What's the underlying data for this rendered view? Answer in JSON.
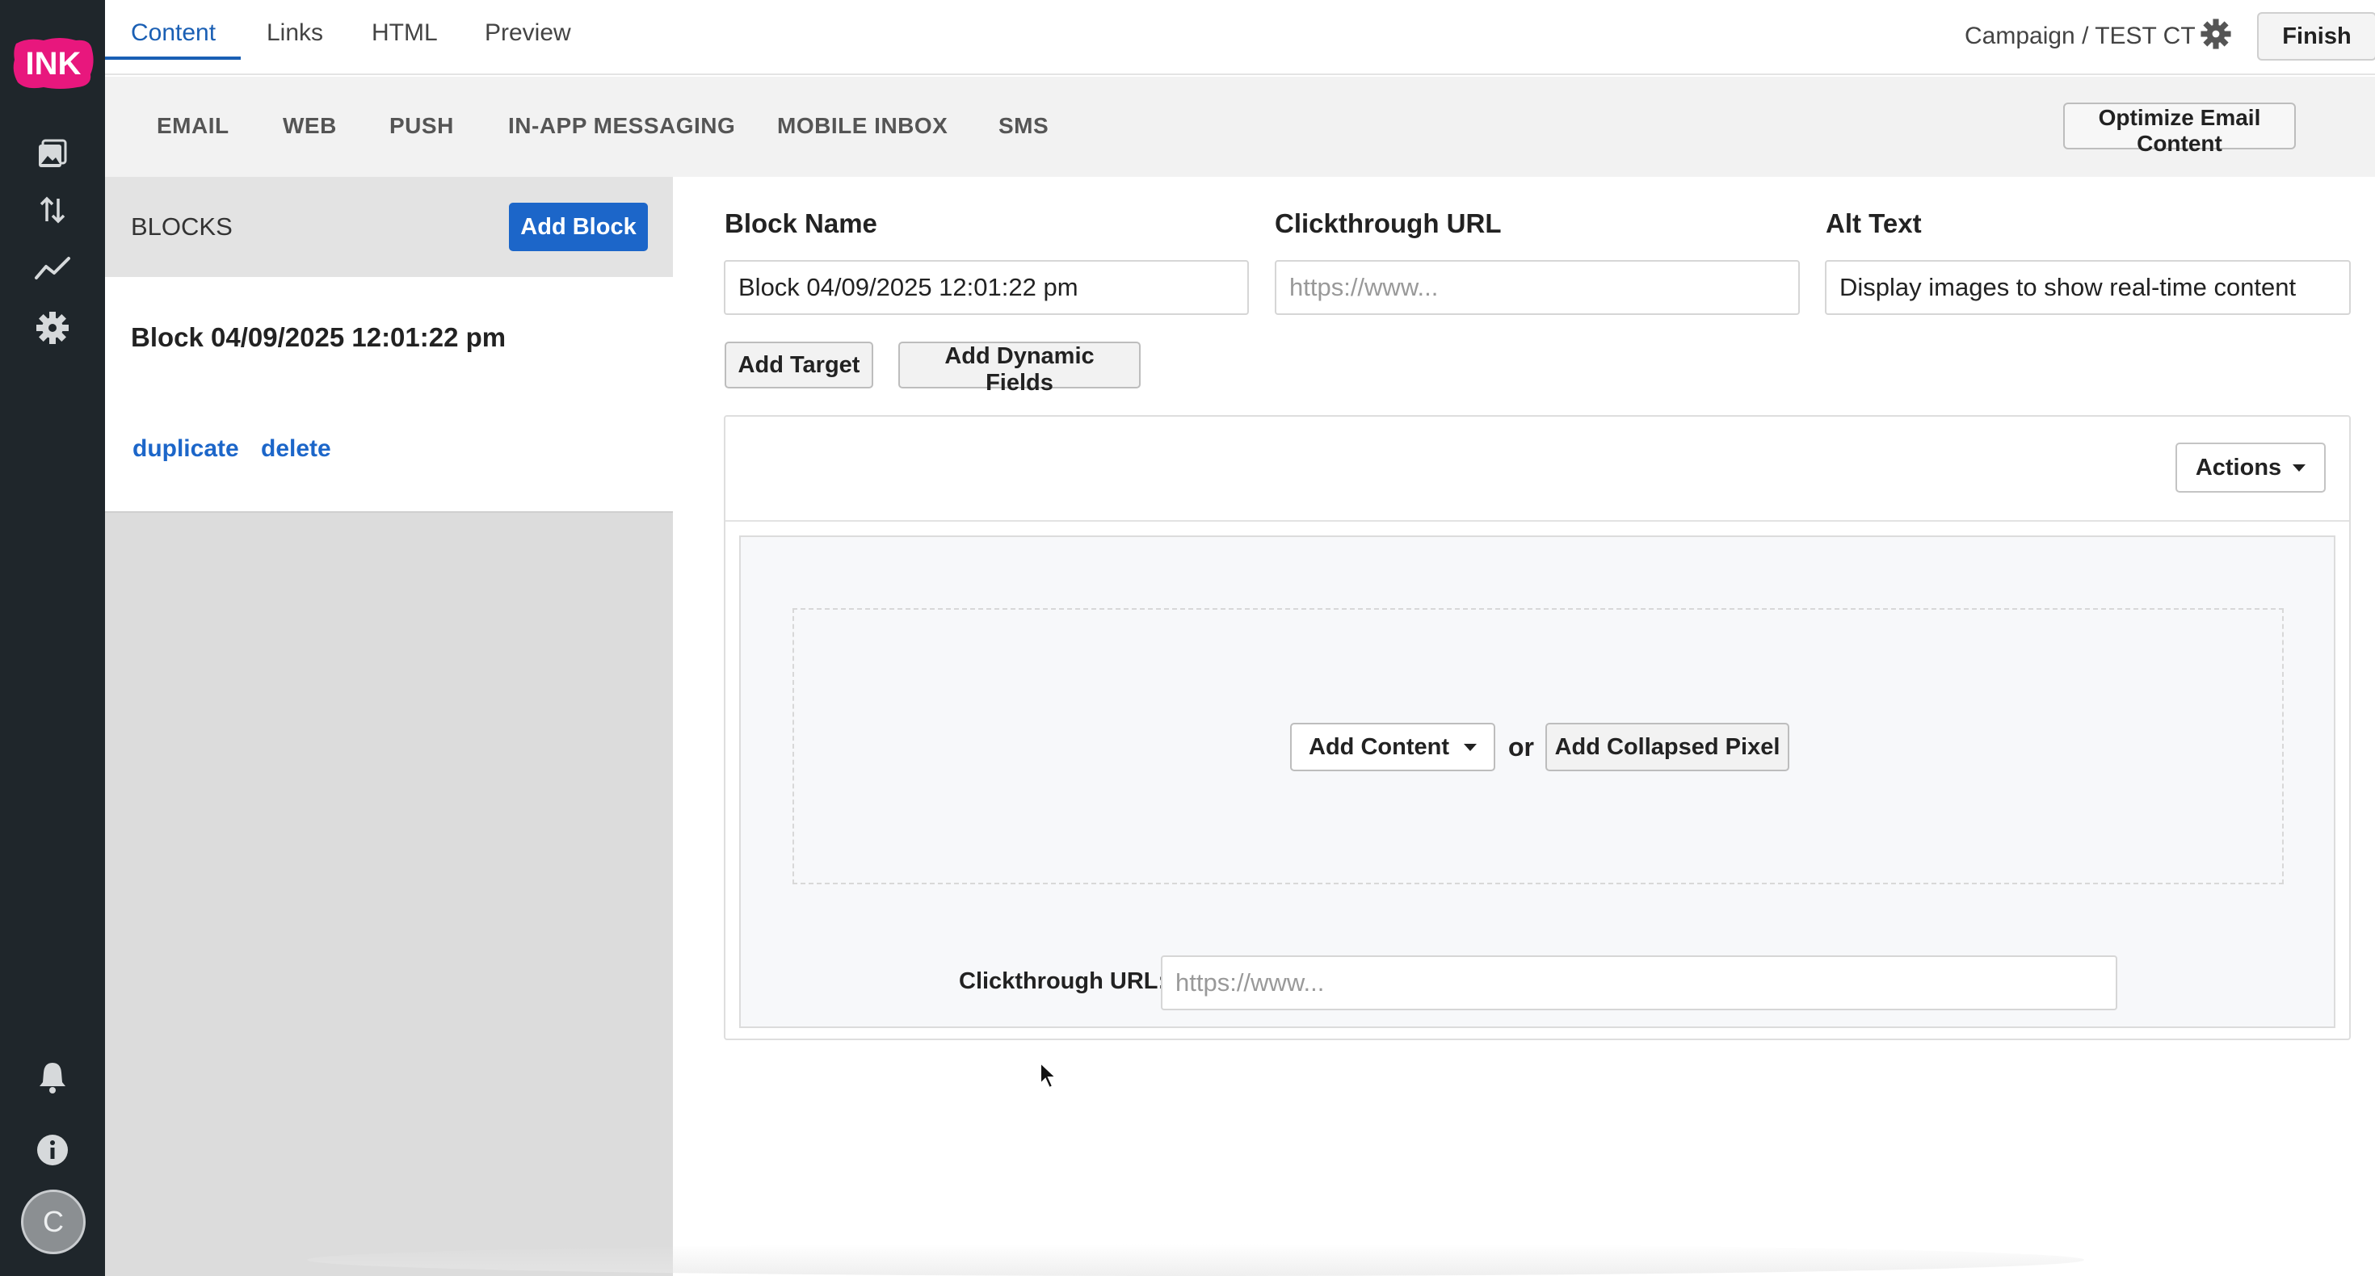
{
  "app": {
    "logo_text": "INK",
    "avatar_initial": "C",
    "brand_color": "#e8177d",
    "accent_color": "#1c66c9"
  },
  "rail": {
    "icons": [
      "image-icon",
      "sort-arrows-icon",
      "analytics-trend-icon",
      "settings-gear-icon"
    ],
    "bottom_icons": [
      "notification-bell-icon",
      "info-icon"
    ]
  },
  "top_tabs": [
    {
      "label": "Content",
      "active": true
    },
    {
      "label": "Links",
      "active": false
    },
    {
      "label": "HTML",
      "active": false
    },
    {
      "label": "Preview",
      "active": false
    }
  ],
  "header": {
    "breadcrumb": "Campaign / TEST CT",
    "finish_label": "Finish"
  },
  "channels": [
    {
      "label": "EMAIL"
    },
    {
      "label": "WEB"
    },
    {
      "label": "PUSH"
    },
    {
      "label": "IN-APP MESSAGING"
    },
    {
      "label": "MOBILE INBOX"
    },
    {
      "label": "SMS"
    }
  ],
  "optimize_label": "Optimize Email Content",
  "blocks": {
    "title": "BLOCKS",
    "add_label": "Add Block",
    "items": [
      {
        "name": "Block 04/09/2025 12:01:22 pm",
        "duplicate_label": "duplicate",
        "delete_label": "delete"
      }
    ]
  },
  "editor": {
    "block_name_label": "Block Name",
    "block_name_value": "Block 04/09/2025 12:01:22 pm",
    "clickthrough_label": "Clickthrough URL",
    "clickthrough_placeholder": "https://www...",
    "alt_text_label": "Alt Text",
    "alt_text_value": "Display images to show real-time content",
    "add_target_label": "Add Target",
    "add_dynamic_label": "Add Dynamic Fields",
    "actions_label": "Actions",
    "add_content_label": "Add Content",
    "or_text": "or",
    "add_pixel_label": "Add Collapsed Pixel",
    "inner_url_label": "Clickthrough URL:",
    "inner_url_placeholder": "https://www..."
  }
}
